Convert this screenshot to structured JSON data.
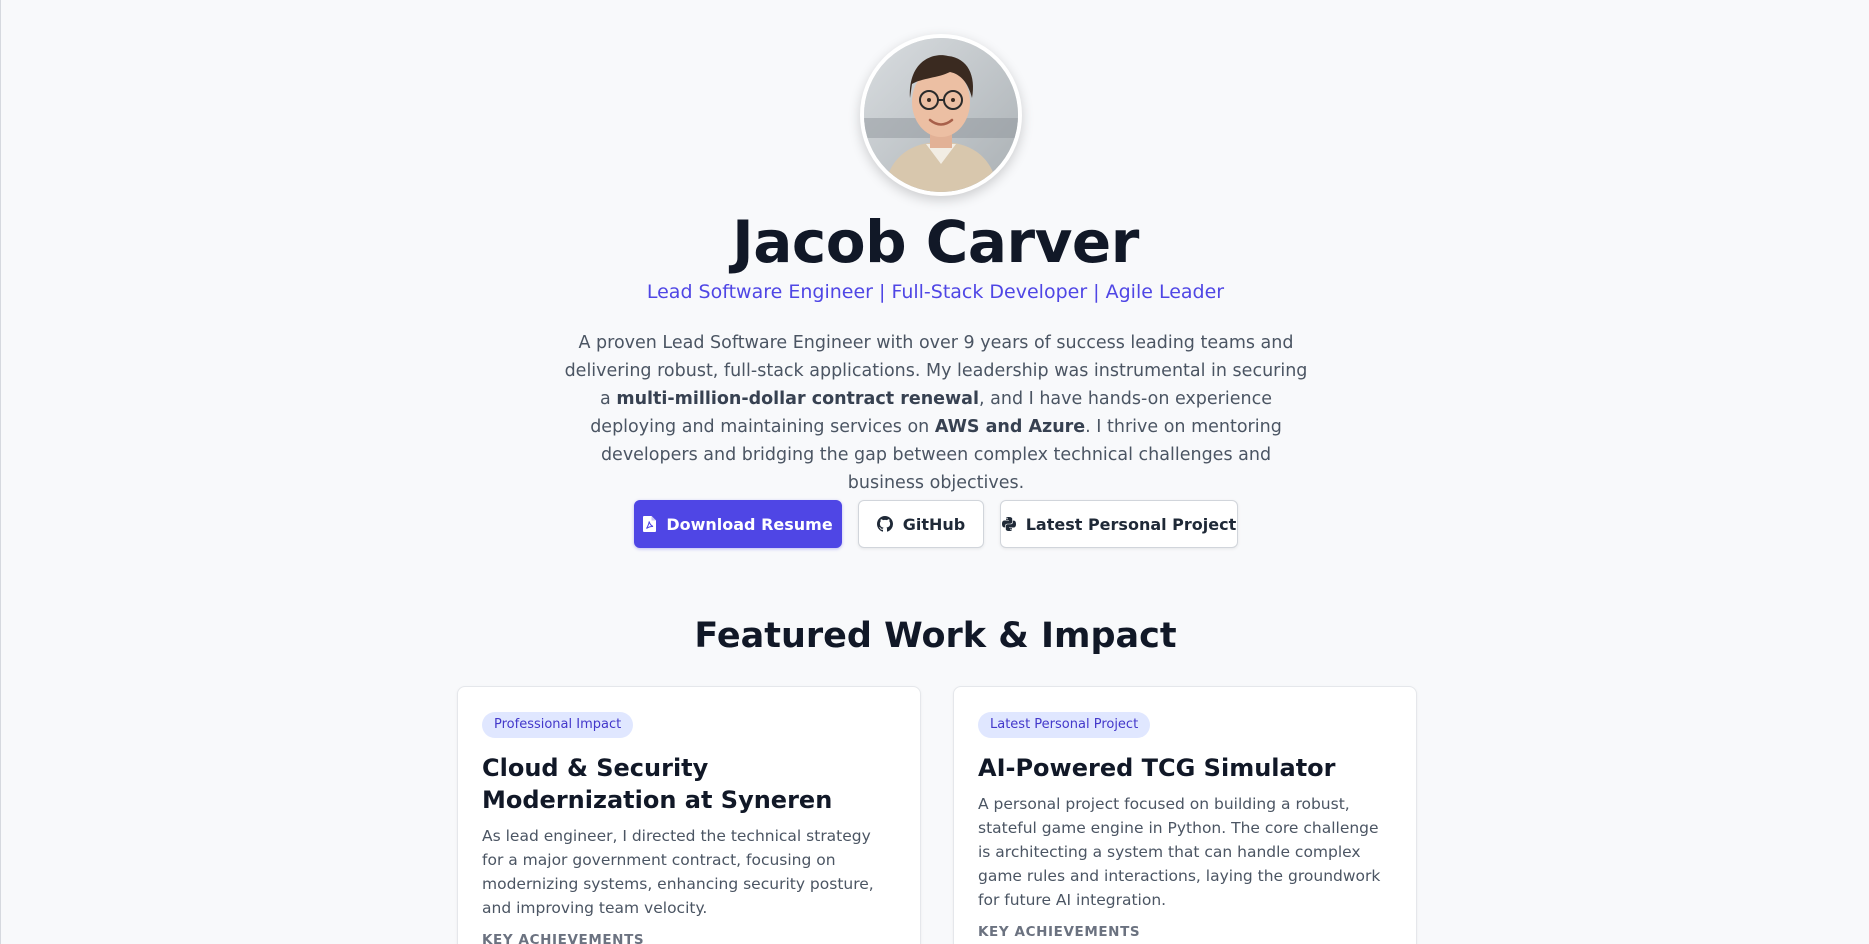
{
  "profile": {
    "name": "Jacob Carver",
    "tagline": "Lead Software Engineer | Full-Stack Developer | Agile Leader",
    "bio": {
      "p1": "A proven Lead Software Engineer with over 9 years of success leading teams and delivering robust, full-stack applications. My leadership was instrumental in securing a ",
      "b1": "multi-million-dollar contract renewal",
      "p2": ", and I have hands-on experience deploying and maintaining services on ",
      "b2": "AWS and Azure",
      "p3": ". I thrive on mentoring developers and bridging the gap between complex technical challenges and business objectives."
    }
  },
  "actions": {
    "resume": {
      "label": "Download Resume",
      "icon": "pdf-file-icon"
    },
    "github": {
      "label": "GitHub",
      "icon": "github-icon"
    },
    "project": {
      "label": "Latest Personal Project",
      "icon": "python-icon"
    }
  },
  "featured": {
    "title": "Featured Work & Impact",
    "cards": [
      {
        "badge": "Professional Impact",
        "title": "Cloud & Security Modernization at Syneren",
        "description": "As lead engineer, I directed the technical strategy for a major government contract, focusing on modernizing systems, enhancing security posture, and improving team velocity.",
        "subheading": "KEY ACHIEVEMENTS"
      },
      {
        "badge": "Latest Personal Project",
        "title": "AI-Powered TCG Simulator",
        "description": "A personal project focused on building a robust, stateful game engine in Python. The core challenge is architecting a system that can handle complex game rules and interactions, laying the groundwork for future AI integration.",
        "subheading": "KEY ACHIEVEMENTS"
      }
    ]
  },
  "colors": {
    "accent": "#4f46e5",
    "badge_bg": "#e0e7ff",
    "heading": "#111827",
    "body_text": "#4b5563",
    "page_bg": "#f8f9fb"
  }
}
